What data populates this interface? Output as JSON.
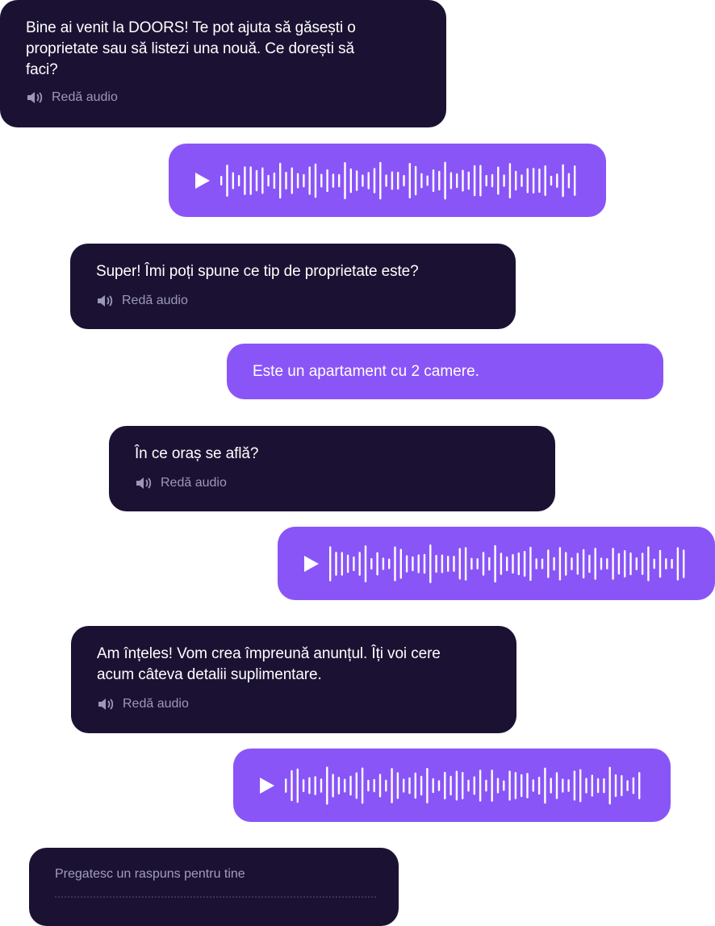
{
  "messages": [
    {
      "kind": "bot",
      "text": "Bine ai venit la DOORS! Te pot ajuta să găsești o proprietate sau să listezi una nouă. Ce dorești să faci?",
      "audio_label": "Redă audio"
    },
    {
      "kind": "voice"
    },
    {
      "kind": "bot",
      "text": "Super!  Îmi poți spune ce tip de proprietate este?",
      "audio_label": "Redă audio"
    },
    {
      "kind": "user",
      "text": "Este un apartament cu 2 camere."
    },
    {
      "kind": "bot",
      "text": "În ce oraș se află?",
      "audio_label": "Redă audio"
    },
    {
      "kind": "voice"
    },
    {
      "kind": "bot",
      "text": "Am înțeles! Vom crea împreună anunțul. Îți voi cere acum câteva detalii suplimentare.",
      "audio_label": "Redă audio"
    },
    {
      "kind": "voice"
    }
  ],
  "typing": {
    "status": "Pregatesc un raspuns pentru tine"
  },
  "colors": {
    "bot_bg": "#1b1233",
    "user_bg": "#8a55f7",
    "muted": "#9c98b6"
  },
  "icons": {
    "speaker": "speaker-icon",
    "play": "play-icon"
  }
}
